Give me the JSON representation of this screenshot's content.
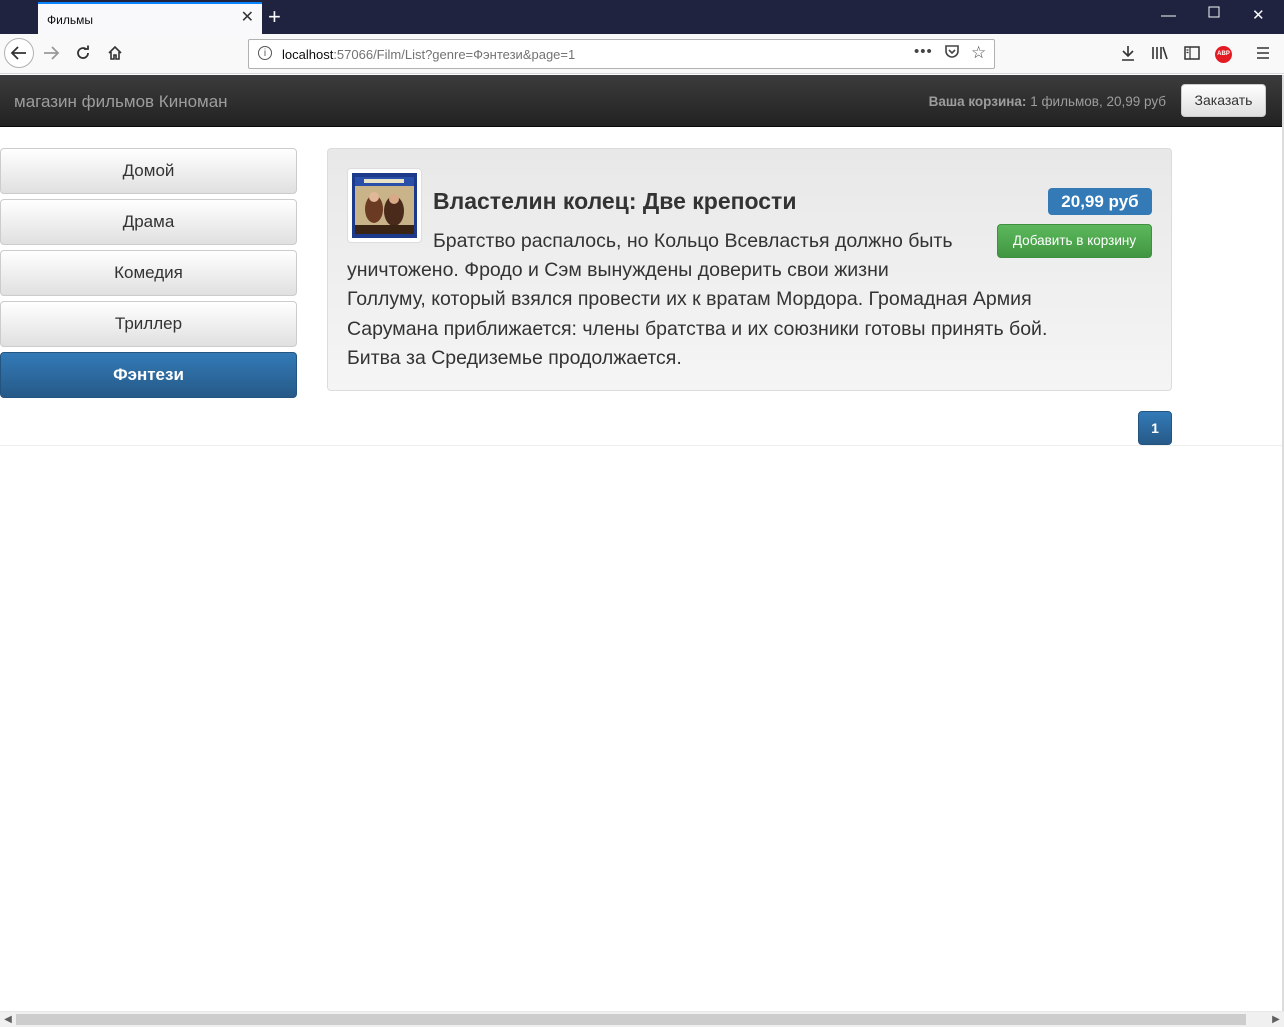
{
  "browser": {
    "tab_title": "Фильмы",
    "url_host": "localhost",
    "url_rest": ":57066/Film/List?genre=Фэнтези&page=1",
    "abp_label": "ABP"
  },
  "header": {
    "brand": "магазин фильмов Киноман",
    "cart_label": "Ваша корзина:",
    "cart_value": "1 фильмов, 20,99 руб",
    "checkout_label": "Заказать"
  },
  "sidebar": {
    "items": [
      {
        "label": "Домой",
        "active": false
      },
      {
        "label": "Драма",
        "active": false
      },
      {
        "label": "Комедия",
        "active": false
      },
      {
        "label": "Триллер",
        "active": false
      },
      {
        "label": "Фэнтези",
        "active": true
      }
    ]
  },
  "product": {
    "title": "Властелин колец: Две крепости",
    "price": "20,99 руб",
    "add_label": "Добавить в корзину",
    "description_lines": [
      "Братство распалось, но Кольцо Всевластья должно быть",
      "уничтожено. Фродо и Сэм вынуждены доверить свои жизни",
      "Голлуму, который взялся провести их к вратам Мордора. Громадная Армия",
      "Сарумана приближается: члены братства и их союзники готовы принять бой.",
      "Битва за Средиземье продолжается."
    ]
  },
  "pagination": {
    "current": "1"
  },
  "colors": {
    "primary": "#337ab7",
    "success": "#5cb85c",
    "navbar": "#222222"
  }
}
